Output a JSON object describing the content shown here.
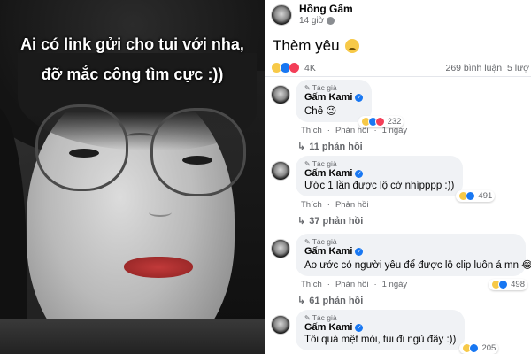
{
  "photo": {
    "caption_line1": "Ai có link gửi cho tui với nha,",
    "caption_line2": "đỡ mắc công tìm cực :))"
  },
  "post": {
    "author": "Hồng Gấm",
    "time": "14 giờ",
    "text": "Thèm yêu",
    "text_emoji": "sad-face-emoji",
    "reactions": [
      "haha",
      "like",
      "love"
    ],
    "reaction_count": "4K",
    "comments_count": "269 bình luận",
    "shares_count": "5 lượ"
  },
  "comments": [
    {
      "badge": "Tác giả",
      "name": "Gấm Kami",
      "text": "Chê 😉",
      "reactions": [
        "haha",
        "like",
        "love"
      ],
      "reaction_count": "232",
      "action_like": "Thích",
      "action_reply": "Phản hồi",
      "time": "1 ngày",
      "replies": "11 phản hồi"
    },
    {
      "badge": "Tác giả",
      "name": "Gấm Kami",
      "text": "Ước 1 lần được lộ cờ nhípppp :))",
      "reactions": [
        "haha",
        "like"
      ],
      "reaction_count": "491",
      "action_like": "Thích",
      "action_reply": "Phản hồi",
      "time": "",
      "replies": "37 phản hồi"
    },
    {
      "badge": "Tác giả",
      "name": "Gấm Kami",
      "text": "Ao ước có người yêu để được lộ clip luôn á mn 😂",
      "reactions": [
        "haha",
        "like"
      ],
      "reaction_count": "498",
      "action_like": "Thích",
      "action_reply": "Phản hồi",
      "time": "1 ngày",
      "replies": "61 phản hồi"
    },
    {
      "badge": "Tác giả",
      "name": "Gấm Kami",
      "text": "Tôi quá mệt mỏi, tui đi ngủ đây :))",
      "reactions": [
        "haha",
        "like"
      ],
      "reaction_count": "205",
      "action_like": "",
      "action_reply": "",
      "time": "",
      "replies": ""
    }
  ],
  "colors": {
    "fb_blue": "#1877f2",
    "bubble_bg": "#f0f2f5",
    "muted_text": "#65676b"
  }
}
